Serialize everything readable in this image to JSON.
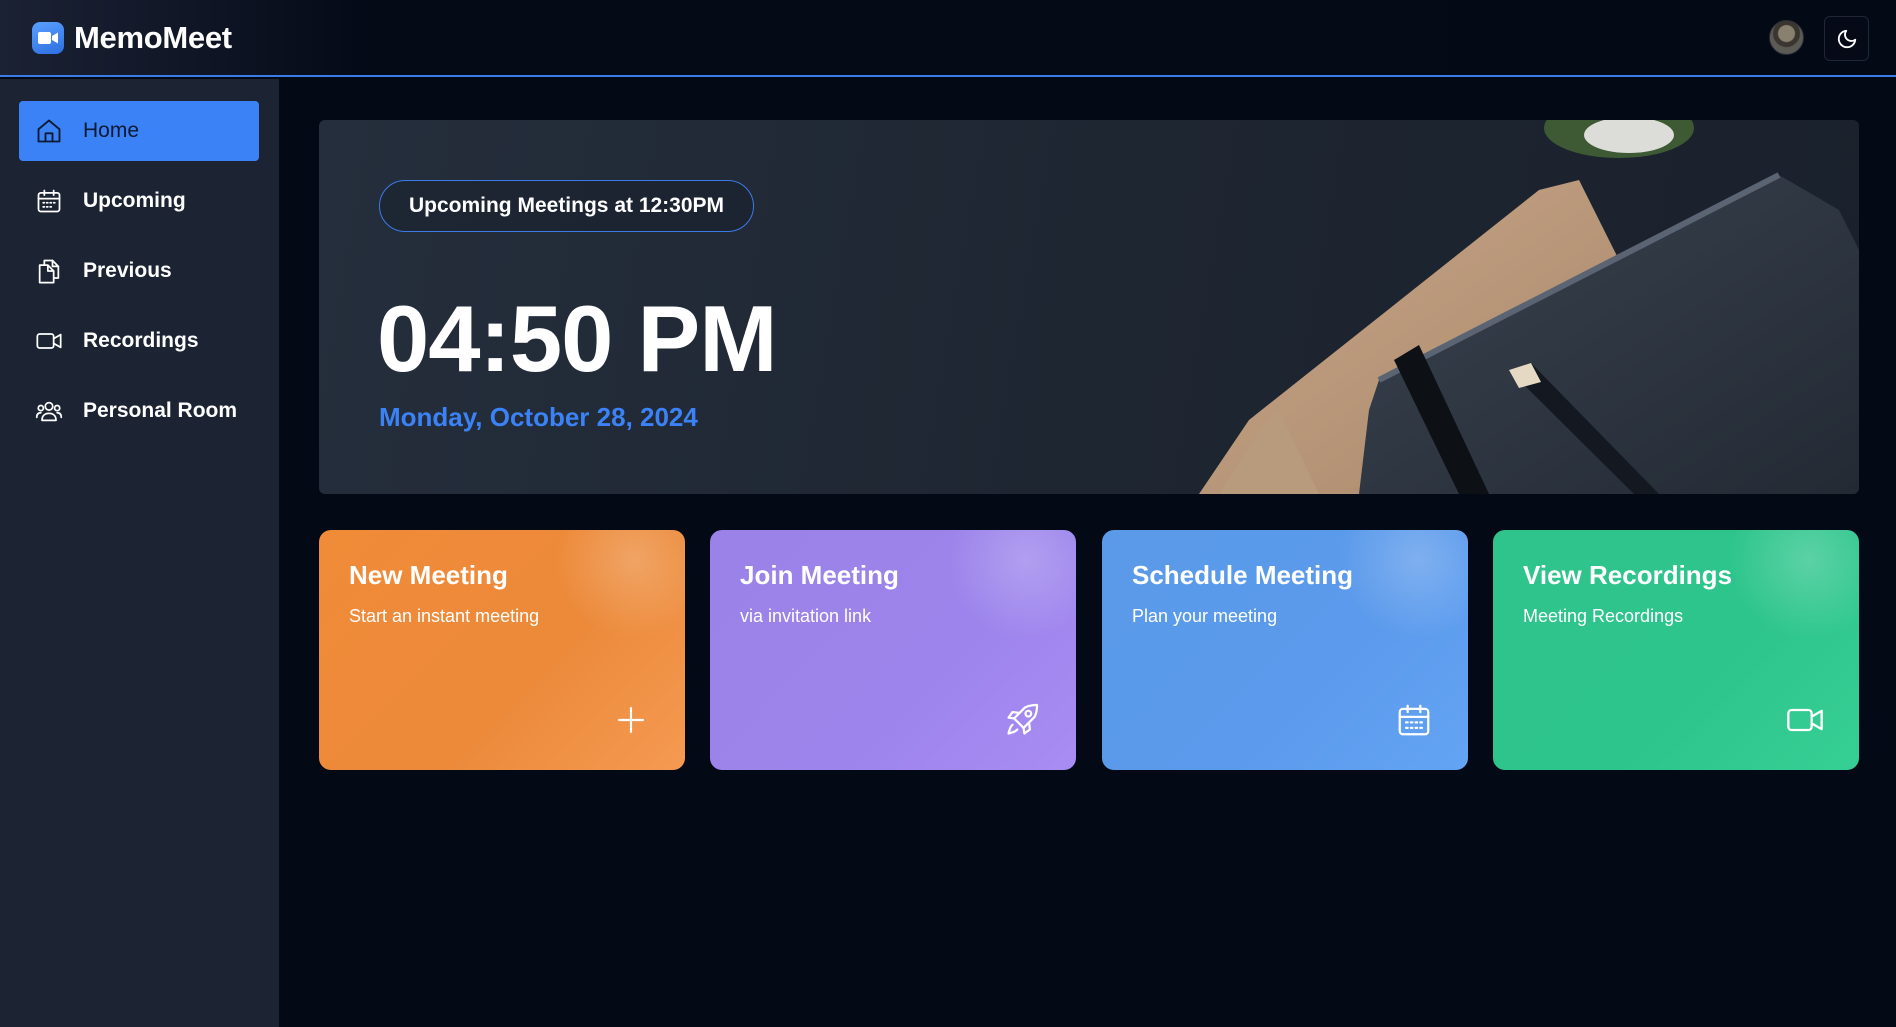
{
  "app": {
    "name": "MemoMeet",
    "logo_icon": "video-camera-icon",
    "accent": "#3b82f6"
  },
  "header": {
    "avatar_icon": "user-avatar",
    "theme_toggle_icon": "moon-icon"
  },
  "sidebar": {
    "items": [
      {
        "label": "Home",
        "icon": "home-icon",
        "active": true
      },
      {
        "label": "Upcoming",
        "icon": "calendar-icon",
        "active": false
      },
      {
        "label": "Previous",
        "icon": "documents-icon",
        "active": false
      },
      {
        "label": "Recordings",
        "icon": "video-icon",
        "active": false
      },
      {
        "label": "Personal Room",
        "icon": "users-icon",
        "active": false
      }
    ]
  },
  "hero": {
    "upcoming_label": "Upcoming Meetings at 12:30PM",
    "time": "04:50 PM",
    "date": "Monday, October 28, 2024"
  },
  "cards": [
    {
      "title": "New Meeting",
      "subtitle": "Start an instant meeting",
      "icon": "plus-icon",
      "color": "#ee8a3a"
    },
    {
      "title": "Join Meeting",
      "subtitle": "via invitation link",
      "icon": "rocket-icon",
      "color": "#9d84ec"
    },
    {
      "title": "Schedule Meeting",
      "subtitle": "Plan your meeting",
      "icon": "calendar-icon",
      "color": "#5b9aec"
    },
    {
      "title": "View Recordings",
      "subtitle": "Meeting Recordings",
      "icon": "video-icon",
      "color": "#2fc58c"
    }
  ]
}
